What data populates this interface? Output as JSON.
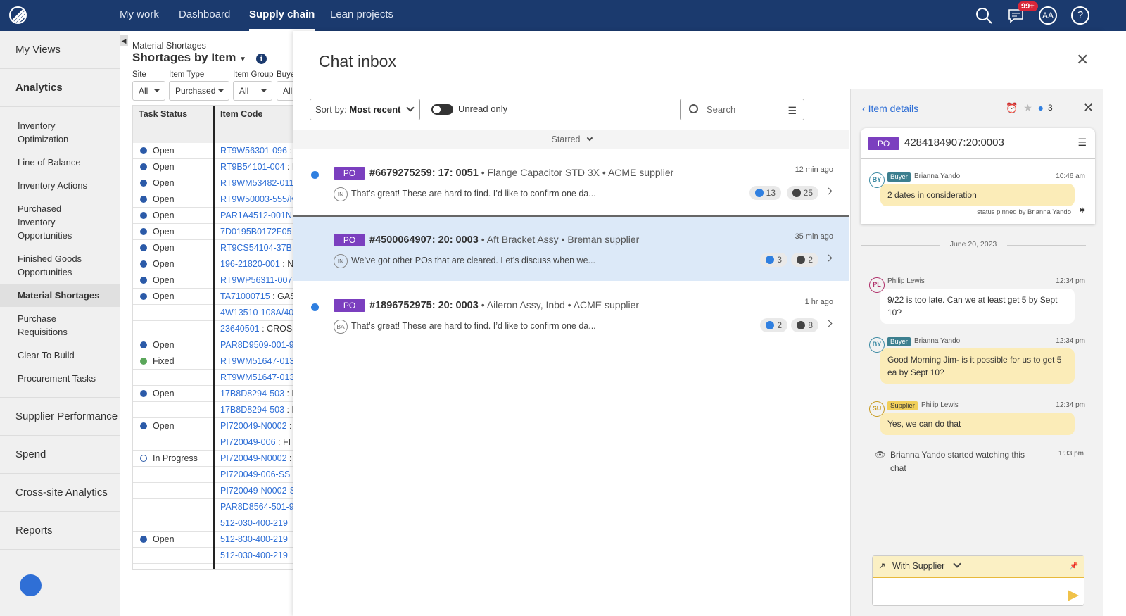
{
  "nav": {
    "items": [
      "My work",
      "Dashboard",
      "Supply chain",
      "Lean projects"
    ],
    "active": "Supply chain",
    "badge": "99+",
    "avatar": "AA",
    "icons": [
      "search-icon",
      "chat-icon",
      "avatar",
      "help-icon"
    ]
  },
  "sidebar": {
    "my_views": "My Views",
    "analytics": "Analytics",
    "items": [
      "Inventory Optimization",
      "Line of Balance",
      "Inventory Actions",
      "Purchased Inventory Opportunities",
      "Finished Goods Opportunities",
      "Material Shortages",
      "Purchase Requisitions",
      "Clear To Build",
      "Procurement Tasks"
    ],
    "active": "Material Shortages",
    "groups": [
      "Supplier Performance",
      "Spend",
      "Cross-site Analytics",
      "Reports"
    ]
  },
  "page": {
    "breadcrumb": "Material Shortages",
    "title": "Shortages by Item",
    "filters": [
      {
        "label": "Site",
        "value": "All"
      },
      {
        "label": "Item Type",
        "value": "Purchased"
      },
      {
        "label": "Item Group",
        "value": "All"
      },
      {
        "label": "Buye",
        "value": "All"
      }
    ],
    "columns": [
      "Task Status",
      "Item Code"
    ],
    "rows": [
      [
        "Open",
        "RT9W56301-096",
        " :"
      ],
      [
        "Open",
        "RT9B54101-004",
        " : F"
      ],
      [
        "Open",
        "RT9WM53482-011",
        ""
      ],
      [
        "Open",
        "RT9W50003-555/K",
        ""
      ],
      [
        "Open",
        "PAR1A4512-001N",
        ""
      ],
      [
        "Open",
        "7D0195B0172F05",
        ""
      ],
      [
        "Open",
        "RT9CS54104-37B",
        ""
      ],
      [
        "Open",
        "196-21820-001",
        " : N"
      ],
      [
        "Open",
        "RT9WP56311-007",
        ""
      ],
      [
        "Open",
        "TA71000715",
        " : GAS"
      ],
      [
        "",
        "4W13510-108A/40",
        ""
      ],
      [
        "",
        "23640501",
        " : CROSS"
      ],
      [
        "Open",
        "PAR8D9509-001-9",
        ""
      ],
      [
        "Fixed",
        "RT9WM51647-013",
        ""
      ],
      [
        "",
        "RT9WM51647-013",
        ""
      ],
      [
        "Open",
        "17B8D8294-503",
        " : E"
      ],
      [
        "",
        "17B8D8294-503",
        " : E"
      ],
      [
        "Open",
        "PI720049-N0002",
        " :"
      ],
      [
        "",
        "PI720049-006",
        " : FIT"
      ],
      [
        "In Progress",
        "PI720049-N0002",
        " :"
      ],
      [
        "",
        "PI720049-006-SS",
        ""
      ],
      [
        "",
        "PI720049-N0002-S",
        ""
      ],
      [
        "",
        "PAR8D8564-501-9",
        ""
      ],
      [
        "",
        "512-030-400-219",
        ""
      ],
      [
        "Open",
        "512-830-400-219",
        ""
      ],
      [
        "",
        "512-030-400-219",
        ""
      ]
    ]
  },
  "status_colors": {
    "Open": "#2b5aa8",
    "Fixed": "#5aa65a",
    "In Progress": "#ffffff"
  },
  "chat": {
    "title": "Chat inbox",
    "sort_label": "Sort by:",
    "sort_value": "Most recent",
    "unread_label": "Unread only",
    "search_placeholder": "Search",
    "starred": "Starred",
    "conversations": [
      {
        "type": "PO",
        "id": "#6679275259: 17: 0051",
        "item": "Flange Capacitor STD 3X",
        "supplier": "ACME supplier",
        "time": "12 min ago",
        "avatar": "IN",
        "preview": "That’s great! These are hard to find. I’d like to confirm one da...",
        "watchers": "13",
        "members": "25",
        "unread": true,
        "selected": false
      },
      {
        "type": "PO",
        "id": "#4500064907: 20: 0003",
        "item": "Aft Bracket Assy",
        "supplier": "Breman supplier",
        "time": "35 min ago",
        "avatar": "IN",
        "preview": "We’ve got other POs that are cleared. Let’s discuss when we...",
        "watchers": "3",
        "members": "2",
        "unread": false,
        "selected": true
      },
      {
        "type": "PO",
        "id": "#1896752975: 20: 0003",
        "item": "Aileron Assy, Inbd",
        "supplier": "ACME supplier",
        "time": "1 hr ago",
        "avatar": "BA",
        "preview": "That’s great! These are hard to find. I’d like to confirm one da...",
        "watchers": "2",
        "members": "8",
        "unread": true,
        "selected": false
      }
    ]
  },
  "details": {
    "back": "Item details",
    "watchers": "3",
    "po_type": "PO",
    "po_number": "4284184907:20:0003",
    "pinned": {
      "avatar": "BY",
      "role": "Buyer",
      "name": "Brianna Yando",
      "time": "10:46 am",
      "text": "2 dates in consideration",
      "note": "status pinned by Brianna Yando"
    },
    "date": "June 20, 2023",
    "messages": [
      {
        "avatar": "PL",
        "role": "",
        "name": "Philip Lewis",
        "time": "12:34 pm",
        "text": "9/22 is too late. Can we at least get 5 by Sept 10?"
      },
      {
        "avatar": "BY",
        "role": "Buyer",
        "name": "Brianna Yando",
        "time": "12:34 pm",
        "text": "Good Morning Jim- is it possible for us to get 5 ea by Sept 10?"
      },
      {
        "avatar": "SU",
        "role": "Supplier",
        "name": "Philip Lewis",
        "time": "12:34 pm",
        "text": "Yes, we can do that"
      }
    ],
    "event": {
      "text": "Brianna Yando started watching this chat",
      "time": "1:33 pm"
    },
    "compose_target": "With Supplier"
  }
}
